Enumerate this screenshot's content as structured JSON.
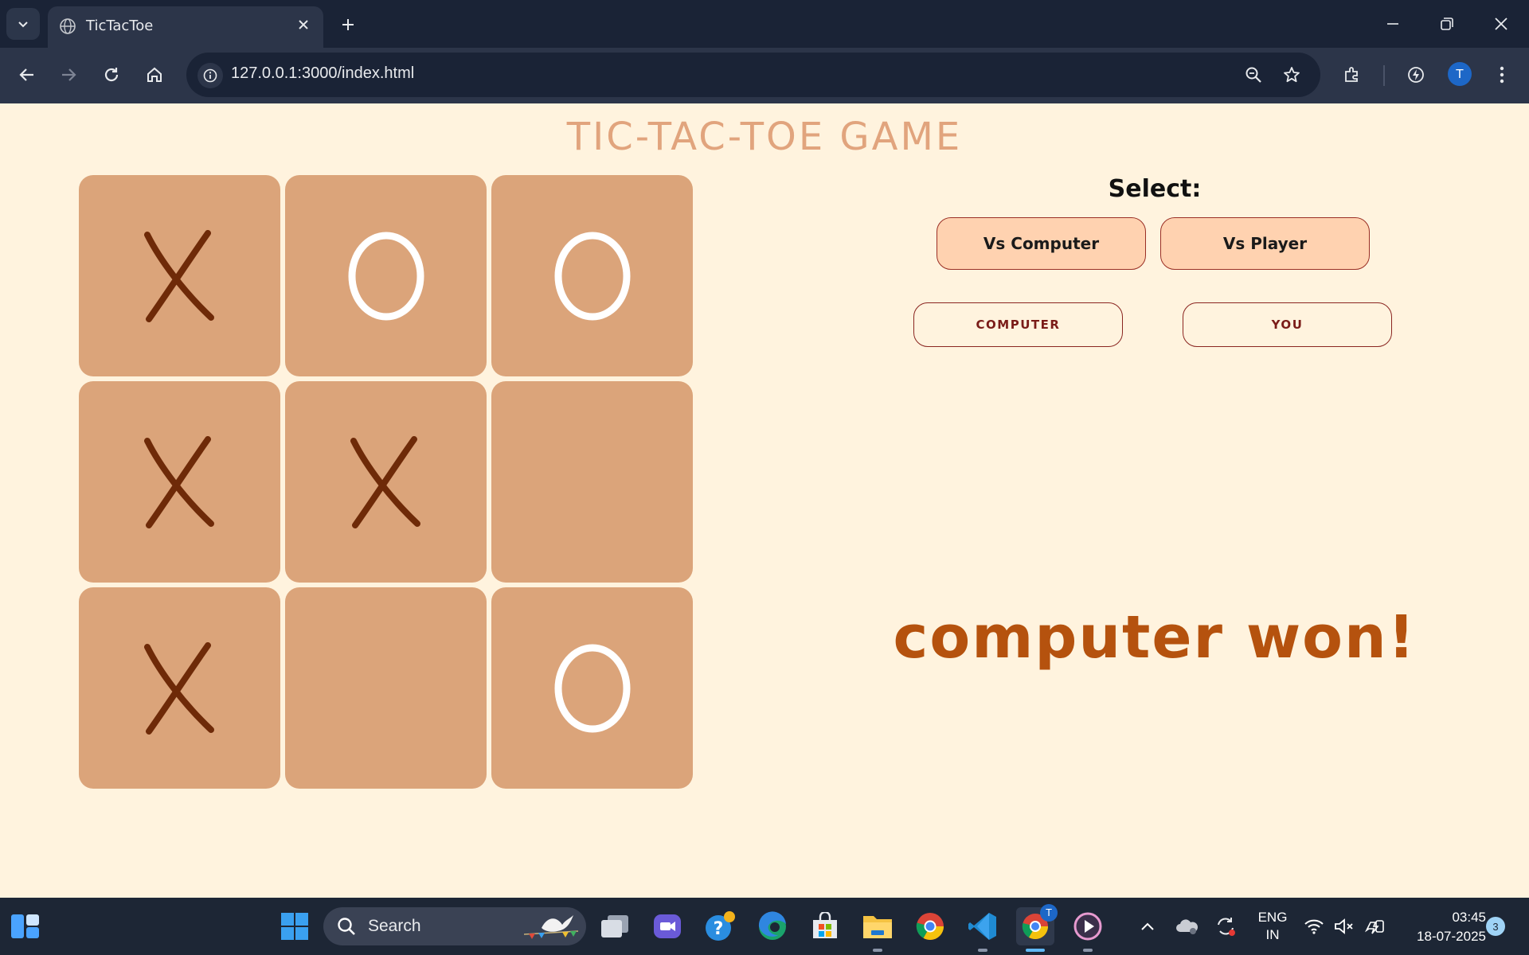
{
  "browser": {
    "tab_title": "TicTacToe",
    "url_host": "127.0.0.1",
    "url_rest": ":3000/index.html",
    "profile_initial": "T"
  },
  "page": {
    "title": "TIC-TAC-TOE GAME",
    "board": [
      [
        "X",
        "O",
        "O"
      ],
      [
        "X",
        "X",
        ""
      ],
      [
        "X",
        "",
        "O"
      ]
    ],
    "select_label": "Select:",
    "mode_buttons": [
      "Vs Computer",
      "Vs Player"
    ],
    "turn_buttons": [
      "COMPUTER",
      "YOU"
    ],
    "result": "computer won!",
    "colors": {
      "background": "#fff3de",
      "cell": "#dba47a",
      "x_mark": "#6e2a08",
      "o_mark": "#ffffff",
      "result": "#b5520e"
    }
  },
  "taskbar": {
    "search_label": "Search",
    "lang_top": "ENG",
    "lang_bottom": "IN",
    "time": "03:45",
    "date": "18-07-2025",
    "notification_count": "3",
    "chrome_badge": "T"
  }
}
